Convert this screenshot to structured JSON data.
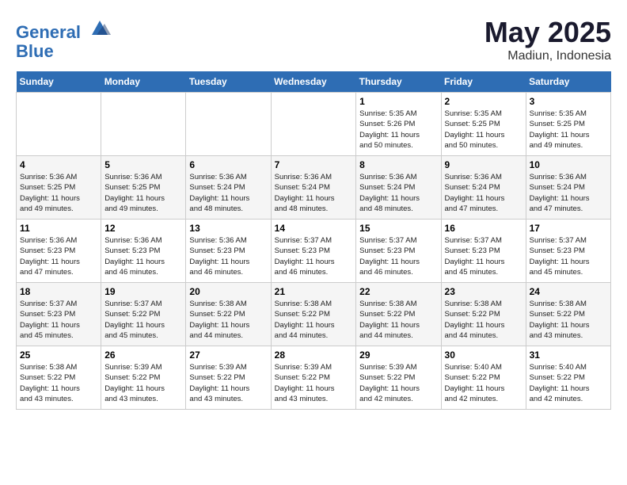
{
  "header": {
    "logo_line1": "General",
    "logo_line2": "Blue",
    "month": "May 2025",
    "location": "Madiun, Indonesia"
  },
  "weekdays": [
    "Sunday",
    "Monday",
    "Tuesday",
    "Wednesday",
    "Thursday",
    "Friday",
    "Saturday"
  ],
  "weeks": [
    [
      {
        "day": "",
        "info": ""
      },
      {
        "day": "",
        "info": ""
      },
      {
        "day": "",
        "info": ""
      },
      {
        "day": "",
        "info": ""
      },
      {
        "day": "1",
        "info": "Sunrise: 5:35 AM\nSunset: 5:26 PM\nDaylight: 11 hours\nand 50 minutes."
      },
      {
        "day": "2",
        "info": "Sunrise: 5:35 AM\nSunset: 5:25 PM\nDaylight: 11 hours\nand 50 minutes."
      },
      {
        "day": "3",
        "info": "Sunrise: 5:35 AM\nSunset: 5:25 PM\nDaylight: 11 hours\nand 49 minutes."
      }
    ],
    [
      {
        "day": "4",
        "info": "Sunrise: 5:36 AM\nSunset: 5:25 PM\nDaylight: 11 hours\nand 49 minutes."
      },
      {
        "day": "5",
        "info": "Sunrise: 5:36 AM\nSunset: 5:25 PM\nDaylight: 11 hours\nand 49 minutes."
      },
      {
        "day": "6",
        "info": "Sunrise: 5:36 AM\nSunset: 5:24 PM\nDaylight: 11 hours\nand 48 minutes."
      },
      {
        "day": "7",
        "info": "Sunrise: 5:36 AM\nSunset: 5:24 PM\nDaylight: 11 hours\nand 48 minutes."
      },
      {
        "day": "8",
        "info": "Sunrise: 5:36 AM\nSunset: 5:24 PM\nDaylight: 11 hours\nand 48 minutes."
      },
      {
        "day": "9",
        "info": "Sunrise: 5:36 AM\nSunset: 5:24 PM\nDaylight: 11 hours\nand 47 minutes."
      },
      {
        "day": "10",
        "info": "Sunrise: 5:36 AM\nSunset: 5:24 PM\nDaylight: 11 hours\nand 47 minutes."
      }
    ],
    [
      {
        "day": "11",
        "info": "Sunrise: 5:36 AM\nSunset: 5:23 PM\nDaylight: 11 hours\nand 47 minutes."
      },
      {
        "day": "12",
        "info": "Sunrise: 5:36 AM\nSunset: 5:23 PM\nDaylight: 11 hours\nand 46 minutes."
      },
      {
        "day": "13",
        "info": "Sunrise: 5:36 AM\nSunset: 5:23 PM\nDaylight: 11 hours\nand 46 minutes."
      },
      {
        "day": "14",
        "info": "Sunrise: 5:37 AM\nSunset: 5:23 PM\nDaylight: 11 hours\nand 46 minutes."
      },
      {
        "day": "15",
        "info": "Sunrise: 5:37 AM\nSunset: 5:23 PM\nDaylight: 11 hours\nand 46 minutes."
      },
      {
        "day": "16",
        "info": "Sunrise: 5:37 AM\nSunset: 5:23 PM\nDaylight: 11 hours\nand 45 minutes."
      },
      {
        "day": "17",
        "info": "Sunrise: 5:37 AM\nSunset: 5:23 PM\nDaylight: 11 hours\nand 45 minutes."
      }
    ],
    [
      {
        "day": "18",
        "info": "Sunrise: 5:37 AM\nSunset: 5:23 PM\nDaylight: 11 hours\nand 45 minutes."
      },
      {
        "day": "19",
        "info": "Sunrise: 5:37 AM\nSunset: 5:22 PM\nDaylight: 11 hours\nand 45 minutes."
      },
      {
        "day": "20",
        "info": "Sunrise: 5:38 AM\nSunset: 5:22 PM\nDaylight: 11 hours\nand 44 minutes."
      },
      {
        "day": "21",
        "info": "Sunrise: 5:38 AM\nSunset: 5:22 PM\nDaylight: 11 hours\nand 44 minutes."
      },
      {
        "day": "22",
        "info": "Sunrise: 5:38 AM\nSunset: 5:22 PM\nDaylight: 11 hours\nand 44 minutes."
      },
      {
        "day": "23",
        "info": "Sunrise: 5:38 AM\nSunset: 5:22 PM\nDaylight: 11 hours\nand 44 minutes."
      },
      {
        "day": "24",
        "info": "Sunrise: 5:38 AM\nSunset: 5:22 PM\nDaylight: 11 hours\nand 43 minutes."
      }
    ],
    [
      {
        "day": "25",
        "info": "Sunrise: 5:38 AM\nSunset: 5:22 PM\nDaylight: 11 hours\nand 43 minutes."
      },
      {
        "day": "26",
        "info": "Sunrise: 5:39 AM\nSunset: 5:22 PM\nDaylight: 11 hours\nand 43 minutes."
      },
      {
        "day": "27",
        "info": "Sunrise: 5:39 AM\nSunset: 5:22 PM\nDaylight: 11 hours\nand 43 minutes."
      },
      {
        "day": "28",
        "info": "Sunrise: 5:39 AM\nSunset: 5:22 PM\nDaylight: 11 hours\nand 43 minutes."
      },
      {
        "day": "29",
        "info": "Sunrise: 5:39 AM\nSunset: 5:22 PM\nDaylight: 11 hours\nand 42 minutes."
      },
      {
        "day": "30",
        "info": "Sunrise: 5:40 AM\nSunset: 5:22 PM\nDaylight: 11 hours\nand 42 minutes."
      },
      {
        "day": "31",
        "info": "Sunrise: 5:40 AM\nSunset: 5:22 PM\nDaylight: 11 hours\nand 42 minutes."
      }
    ]
  ]
}
